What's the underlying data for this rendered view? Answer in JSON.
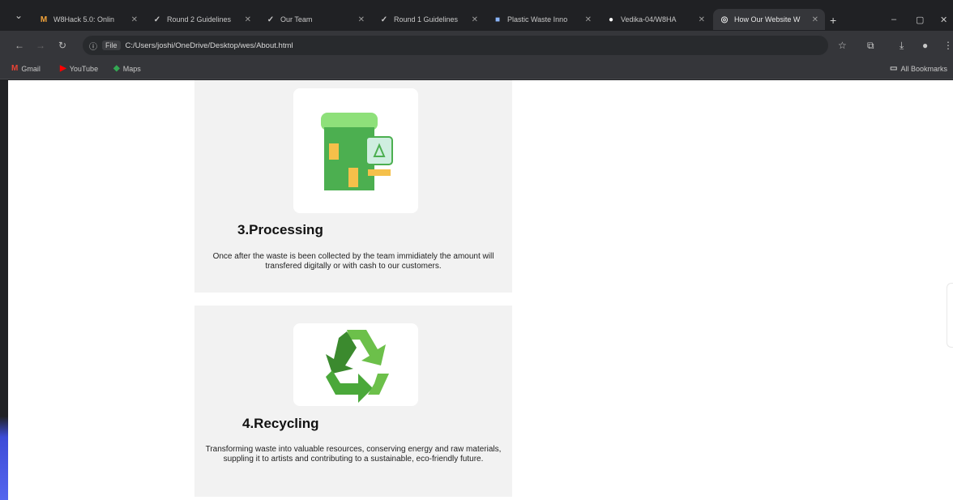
{
  "browser": {
    "tabs": [
      {
        "label": "W8Hack 5.0: Onlin",
        "icon": "M",
        "color": "#f2a33a"
      },
      {
        "label": "Round 2 Guidelines",
        "icon": "✓",
        "color": "#e0e0e0"
      },
      {
        "label": "Our Team",
        "icon": "✓",
        "color": "#e0e0e0"
      },
      {
        "label": "Round 1 Guidelines",
        "icon": "✓",
        "color": "#e0e0e0"
      },
      {
        "label": "Plastic Waste Inno",
        "icon": "■",
        "color": "#8ab4f8"
      },
      {
        "label": "Vedika-04/W8HA",
        "icon": "●",
        "color": "#ffffff"
      },
      {
        "label": "How Our Website W",
        "icon": "◎",
        "color": "#c0c0c0",
        "active": true
      }
    ],
    "new_tab": "+",
    "minimize": "–",
    "maximize": "▢",
    "close": "✕",
    "omnibox": {
      "info": "ⓘ",
      "scheme": "File",
      "url": "C:/Users/joshi/OneDrive/Desktop/wes/About.html"
    },
    "bookmarks": [
      {
        "label": "Gmail",
        "icon": "M",
        "color": "#ea4335"
      },
      {
        "label": "YouTube",
        "icon": "▶",
        "color": "#ff0000"
      },
      {
        "label": "Maps",
        "icon": "◆",
        "color": "#34a853"
      }
    ],
    "all_bookmarks": "All Bookmarks"
  },
  "cards": [
    {
      "title": "3.Processing",
      "description": "Once after the waste is been collected by the team immidiately the amount will transfered digitally or with cash to our customers."
    },
    {
      "title": "4.Recycling",
      "description": "Transforming waste into valuable resources, conserving energy and raw materials, suppling it to artists and contributing to a sustainable, eco-friendly future."
    }
  ],
  "colors": {
    "recycle_green_dark": "#3b8a2e",
    "recycle_green_light": "#6cc04a",
    "bin_green": "#4caf50",
    "bin_lid": "#8ee07a",
    "accent_yellow": "#f5c04a"
  }
}
